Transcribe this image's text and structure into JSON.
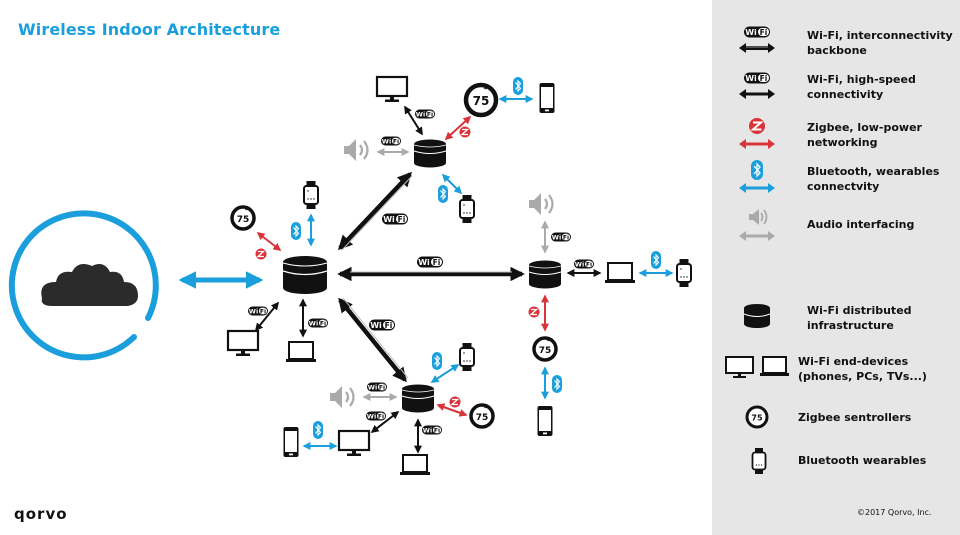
{
  "header": {
    "title": "Wireless Indoor Architecture"
  },
  "footer": {
    "logo": "qorvo",
    "copyright": "©2017 Qorvo, Inc."
  },
  "colors": {
    "title_blue": "#1a9fdc",
    "bluetooth": "#1a9fdc",
    "zigbee": "#d9343a",
    "audio": "#aaaaaa",
    "wifi": "#111111",
    "legend_bg": "#e6e6e6"
  },
  "badges": {
    "wifi": "Wi Fi",
    "thermostat_value": "75",
    "bluetooth": "bluetooth",
    "zigbee": "Z"
  },
  "legend": {
    "items": [
      {
        "icon": "wifi-backbone-icon",
        "label": "Wi-Fi, interconnectivity backbone"
      },
      {
        "icon": "wifi-highspeed-icon",
        "label": "Wi-Fi, high-speed connectivity"
      },
      {
        "icon": "zigbee-icon",
        "label": "Zigbee, low-power networking"
      },
      {
        "icon": "bluetooth-icon",
        "label": "Bluetooth, wearables connectvity"
      },
      {
        "icon": "audio-icon",
        "label": "Audio interfacing"
      },
      {
        "icon": "wifi-node-icon",
        "label": "Wi-Fi distributed infrastructure"
      },
      {
        "icon": "end-devices-icon",
        "label": "Wi-Fi end-devices (phones, PCs, TVs...)"
      },
      {
        "icon": "thermostat-icon",
        "label": "Zigbee sentrollers"
      },
      {
        "icon": "smartwatch-icon",
        "label": "Bluetooth wearables"
      }
    ]
  },
  "diagram": {
    "nodes": [
      {
        "id": "cloud",
        "label": "Cloud"
      },
      {
        "id": "hub-main",
        "label": "Main Wi-Fi node"
      },
      {
        "id": "hub-top",
        "label": "Top Wi-Fi node"
      },
      {
        "id": "hub-right",
        "label": "Right Wi-Fi node"
      },
      {
        "id": "hub-bottom",
        "label": "Bottom Wi-Fi node"
      }
    ]
  }
}
